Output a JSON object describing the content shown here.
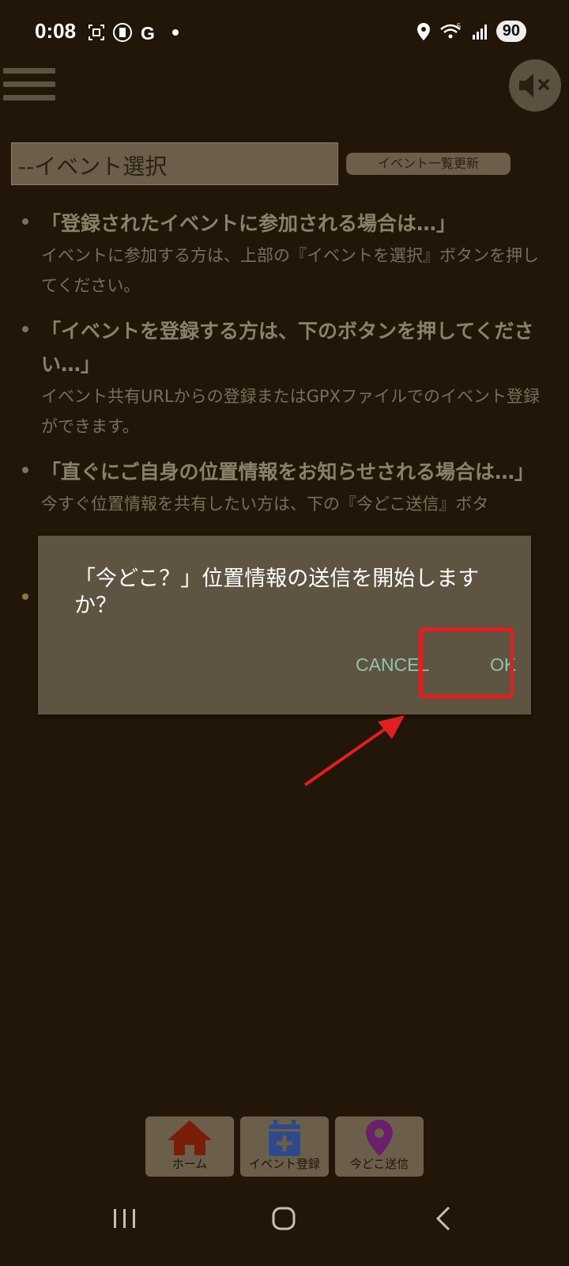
{
  "status_bar": {
    "time": "0:08",
    "battery": "90",
    "network_label": "5"
  },
  "event_select": {
    "placeholder": "--イベント選択"
  },
  "refresh_button": {
    "label": "イベント一覧更新"
  },
  "info": [
    {
      "title": "「登録されたイベントに参加される場合は…」",
      "desc": "イベントに参加する方は、上部の『イベントを選択』ボタンを押してください。"
    },
    {
      "title": "「イベントを登録する方は、下のボタンを押してください…」",
      "desc": "イベント共有URLからの登録またはGPXファイルでのイベント登録ができます。"
    },
    {
      "title": "「直ぐにご自身の位置情報をお知らせされる場合は…」",
      "desc": "今すぐ位置情報を共有したい方は、下の『今どこ送信』ボタ"
    }
  ],
  "dialog": {
    "message": "「今どこ？」位置情報の送信を開始しますか？",
    "cancel": "CANCEL",
    "ok": "OK"
  },
  "bottom_nav": [
    {
      "label": "ホーム",
      "icon": "home-icon",
      "color": "#7a1e0a"
    },
    {
      "label": "イベント登録",
      "icon": "calendar-add-icon",
      "color": "#2e4a8a"
    },
    {
      "label": "今どこ送信",
      "icon": "map-pin-icon",
      "color": "#6a1f6a"
    }
  ],
  "colors": {
    "background": "#211607",
    "dialog": "#5f5341",
    "accent_text": "#8fc6aa",
    "highlight": "#e02020"
  }
}
